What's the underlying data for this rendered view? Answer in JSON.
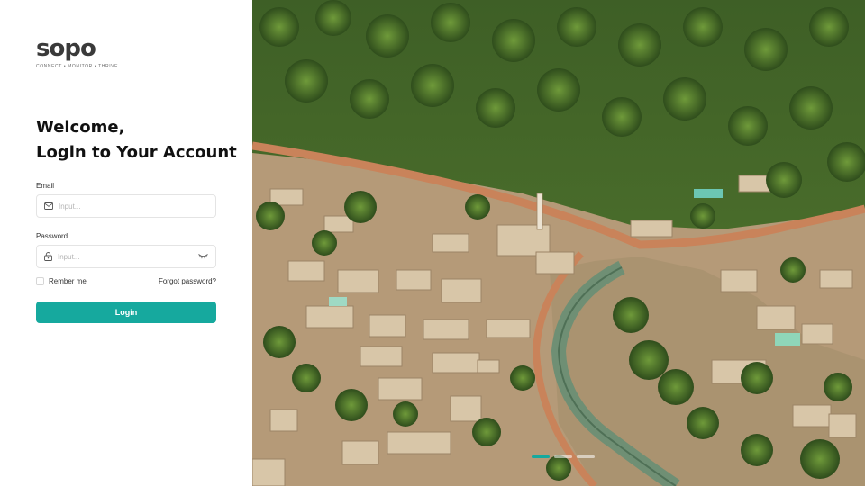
{
  "brand": {
    "name": "sopo",
    "tagline": "CONNECT • MONITOR • THRIVE",
    "accent_color": "#16a99e"
  },
  "heading": {
    "line1": "Welcome,",
    "line2": "Login to Your Account"
  },
  "form": {
    "email": {
      "label": "Email",
      "placeholder": "Input...",
      "icon": "mail-icon"
    },
    "password": {
      "label": "Password",
      "placeholder": "Input...",
      "icon": "lock-icon",
      "toggle_icon": "eye-closed-icon"
    },
    "remember_label": "Rember me",
    "forgot_label": "Forgot password?",
    "submit_label": "Login"
  },
  "hero": {
    "image": "aerial photo of a village with palm trees and a canal",
    "slides_total": 3,
    "active_slide": 1
  }
}
